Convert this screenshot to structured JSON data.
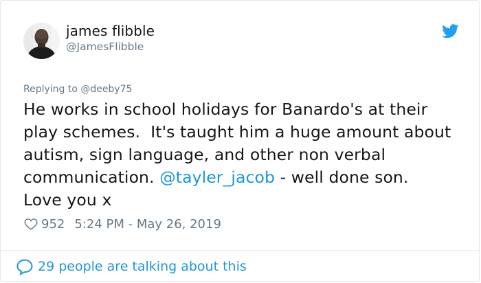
{
  "author": {
    "display_name": "james flibble",
    "handle": "@JamesFlibble",
    "avatar_icon": "user-avatar-photo"
  },
  "reply": {
    "prefix": "Replying to ",
    "to": "@deeby75"
  },
  "tweet": {
    "line1": "He works in school holidays for Banardo's at their",
    "line2": "play schemes.  It's taught him a huge amount about",
    "line3": "autism, sign language, and other non verbal",
    "line4_text": "communication. ",
    "line4_mention": "@tayler_jacob",
    "line4_tail": " - well done son.",
    "line5": "Love you x"
  },
  "meta": {
    "like_icon": "heart-icon",
    "likes": "952",
    "timestamp": "5:24 PM - May 26, 2019"
  },
  "footer": {
    "icon": "speech-bubble-icon",
    "talking_text": "29 people are talking about this"
  },
  "colors": {
    "brand": "#1da1f2",
    "link": "#1b95e0",
    "text": "#14171a",
    "muted": "#657786"
  }
}
